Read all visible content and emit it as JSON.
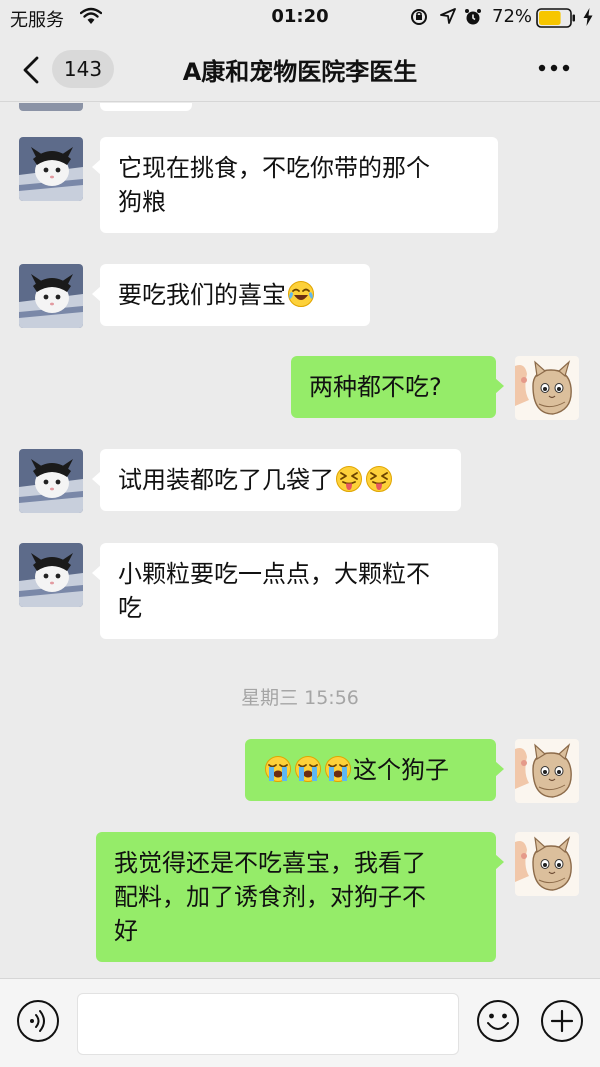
{
  "status_bar": {
    "carrier": "无服务",
    "time": "01:20",
    "battery_percent": "72%",
    "battery_level": 0.72,
    "icons": [
      "wifi-icon",
      "rotation-lock-icon",
      "location-icon",
      "alarm-icon",
      "battery-icon",
      "charging-icon"
    ]
  },
  "nav": {
    "unread_count": "143",
    "title": "A康和宠物医院李医生",
    "icons": [
      "back-chevron-icon",
      "more-icon"
    ]
  },
  "messages": [
    {
      "sender": "doctor",
      "lines": [
        "它现在挑食，不吃你带的那个",
        "狗粮"
      ]
    },
    {
      "sender": "doctor",
      "text": "要吃我们的喜宝",
      "emoji_after": [
        "tears-of-joy-emoji"
      ]
    },
    {
      "sender": "me",
      "text": "两种都不吃?"
    },
    {
      "sender": "doctor",
      "text": "试用装都吃了几袋了",
      "emoji_after": [
        "squinting-tongue-emoji",
        "squinting-tongue-emoji"
      ]
    },
    {
      "sender": "doctor",
      "lines": [
        "小颗粒要吃一点点，大颗粒不",
        "吃"
      ]
    },
    {
      "sender": "me",
      "emoji_before": [
        "loudly-crying-emoji",
        "loudly-crying-emoji",
        "loudly-crying-emoji"
      ],
      "text": "这个狗子"
    },
    {
      "sender": "me",
      "lines": [
        "我觉得还是不吃喜宝，我看了",
        "配料，加了诱食剂，对狗子不",
        "好"
      ]
    }
  ],
  "timestamp": "星期三 15:56",
  "input_bar": {
    "icons": [
      "voice-icon",
      "emoji-icon",
      "plus-icon"
    ]
  },
  "colors": {
    "background": "#ebebeb",
    "incoming_bubble": "#ffffff",
    "outgoing_bubble": "#95ec69",
    "battery_fill": "#f7c600",
    "timestamp_text": "#a5a5a5"
  }
}
